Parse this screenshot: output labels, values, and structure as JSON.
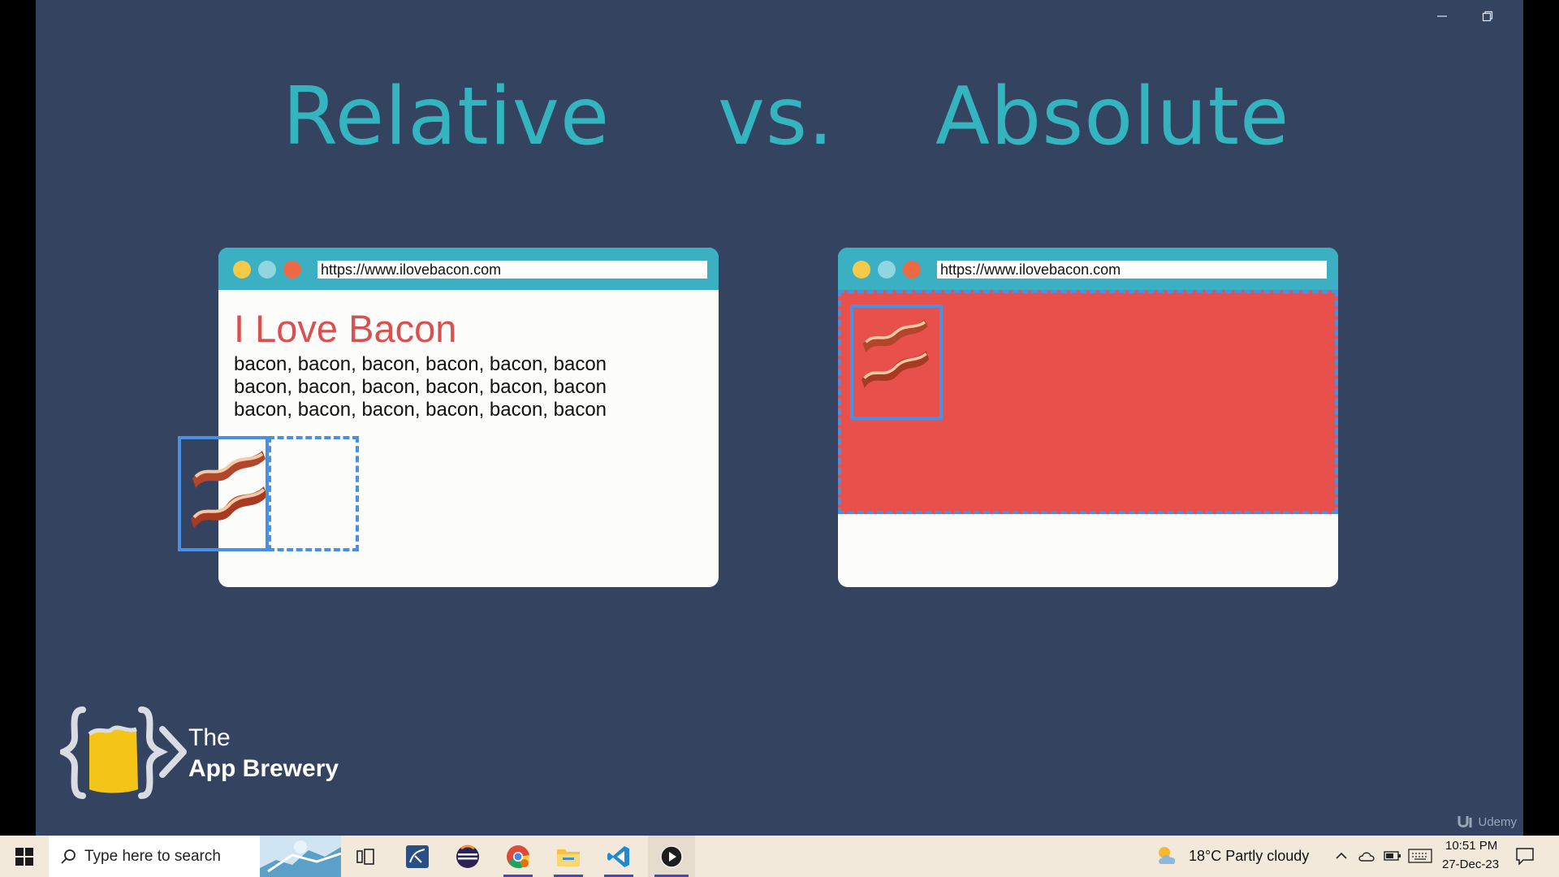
{
  "window": {
    "minimize_icon": "minimize-icon",
    "restore_icon": "restore-icon",
    "close_icon": "close-icon"
  },
  "slide": {
    "title_left": "Relative",
    "title_mid": "vs.",
    "title_right": "Absolute",
    "left_browser": {
      "url": "https://www.ilovebacon.com",
      "heading": "I Love Bacon",
      "lines": [
        "bacon, bacon, bacon, bacon, bacon, bacon",
        "bacon, bacon, bacon, bacon, bacon, bacon",
        "bacon, bacon, bacon, bacon, bacon, bacon"
      ]
    },
    "right_browser": {
      "url": "https://www.ilovebacon.com"
    },
    "logo": {
      "line1": "The",
      "line2": "App Brewery"
    },
    "watermark": "Udemy"
  },
  "colors": {
    "slide_bg": "#334360",
    "title": "#33b4bf",
    "browser_bar": "#3bb0c3",
    "heading_red": "#d85050",
    "red_area": "#e8504c",
    "outline_blue": "#4a90e2",
    "dot_yellow": "#f7c948",
    "dot_cyan": "#8fd6e1",
    "dot_orange": "#ee6a44",
    "taskbar_bg": "#f3e9da"
  },
  "taskbar": {
    "search_placeholder": "Type here to search",
    "apps": [
      "task-view-icon",
      "mysql-workbench-icon",
      "eclipse-icon",
      "chrome-icon",
      "file-explorer-icon",
      "vscode-icon",
      "media-player-icon"
    ],
    "weather": "18°C  Partly cloudy",
    "time": "10:51 PM",
    "date": "27-Dec-23"
  }
}
